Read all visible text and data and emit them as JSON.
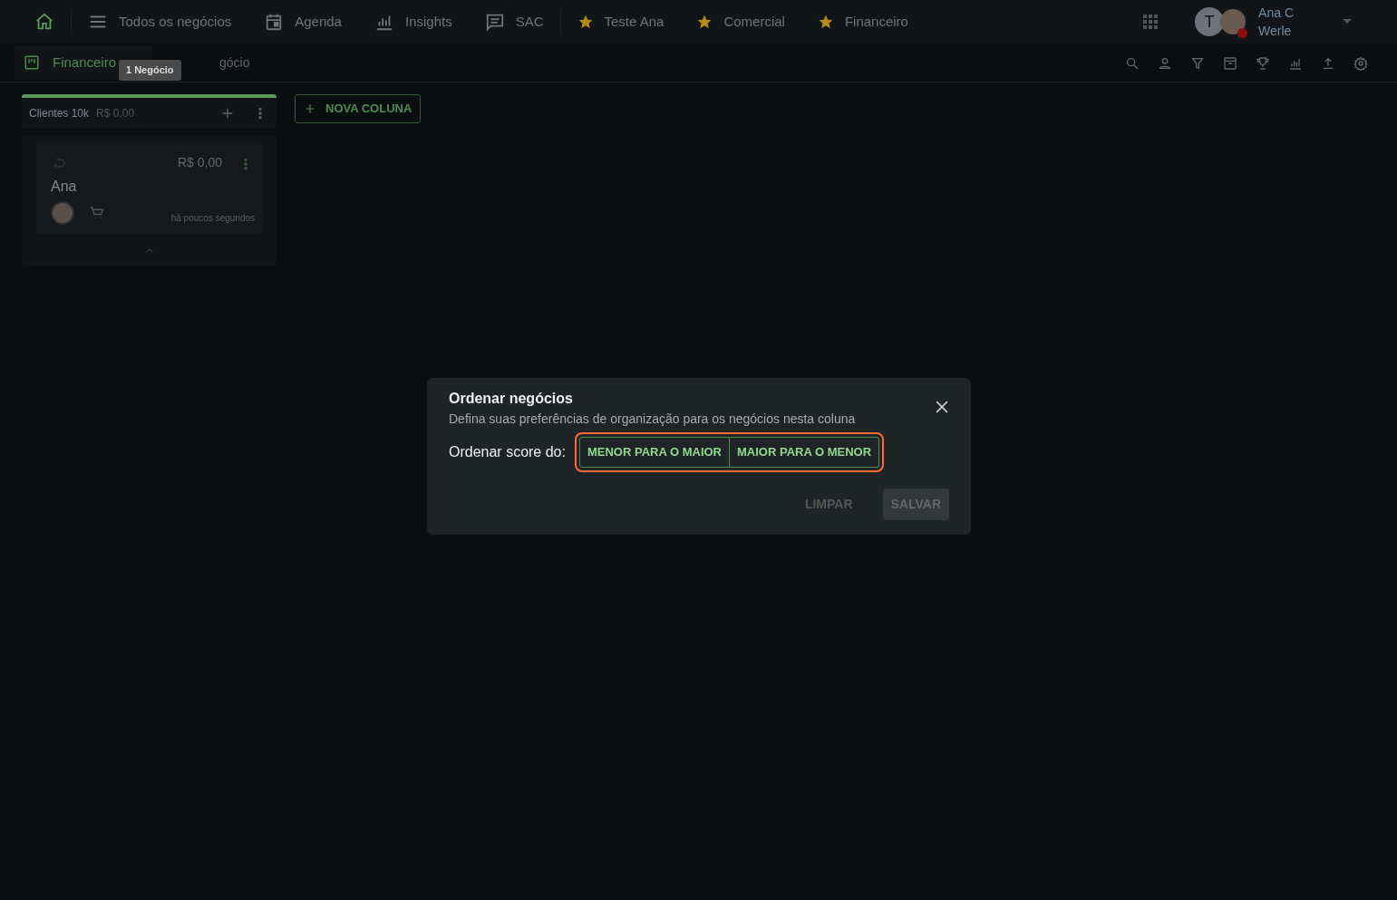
{
  "topnav": {
    "items": [
      {
        "kind": "home"
      },
      {
        "kind": "list",
        "label": "Todos os negócios"
      },
      {
        "kind": "calendar",
        "label": "Agenda"
      },
      {
        "kind": "chart",
        "label": "Insights"
      },
      {
        "kind": "chat",
        "label": "SAC"
      },
      {
        "kind": "star",
        "label": "Teste Ana"
      },
      {
        "kind": "star",
        "label": "Comercial"
      },
      {
        "kind": "star",
        "label": "Financeiro"
      }
    ],
    "user": {
      "initial": "T",
      "name_line1": "Ana C",
      "name_line2": "Werle",
      "online": false
    }
  },
  "board": {
    "title": "Financeiro",
    "subtitle_visible": "gócio",
    "tooltip": "1 Negócio"
  },
  "columns": [
    {
      "name": "Clientes 10k",
      "total": "R$ 0,00",
      "color": "#5a9a5a",
      "cards": [
        {
          "name": "Ana",
          "value": "R$ 0,00",
          "time": "há poucos segundos"
        }
      ]
    }
  ],
  "new_column_button": "NOVA COLUNA",
  "dialog": {
    "title": "Ordenar negócios",
    "description": "Defina suas preferências de organização para os negócios nesta coluna",
    "label": "Ordenar score do:",
    "options": [
      {
        "label": "MENOR PARA O MAIOR",
        "selected": false
      },
      {
        "label": "MAIOR PARA O MENOR",
        "selected": false
      }
    ],
    "clear_button": "LIMPAR",
    "save_button": {
      "label": "SALVAR",
      "disabled": true
    }
  }
}
